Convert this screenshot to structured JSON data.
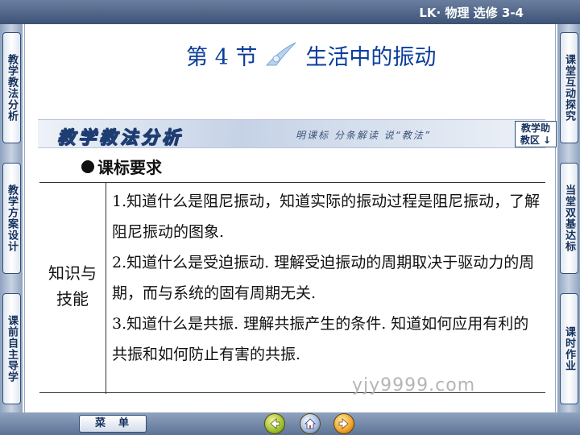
{
  "header": {
    "course": "LK· 物理  选修  3-4"
  },
  "left_tabs": [
    {
      "label": "教学教法分析"
    },
    {
      "label": "教学方案设计"
    },
    {
      "label": "课前自主导学"
    }
  ],
  "right_tabs": [
    {
      "label": "课堂互动探究"
    },
    {
      "label": "当堂双基达标"
    },
    {
      "label": "课时作业"
    }
  ],
  "title": {
    "section": "第 4 节",
    "name": "生活中的振动"
  },
  "banner": {
    "section_label": "教学教法分析",
    "slogan": "明课标  分条解读  说“教法”",
    "help_line1": "教学助",
    "help_line2": "教区 ↓"
  },
  "heading": "课标要求",
  "table": {
    "row_head_line1": "知识与",
    "row_head_line2": "技能",
    "items": [
      "1.知道什么是阻尼振动，知道实际的振动过程是阻尼振动，了解阻尼振动的图象.",
      "2.知道什么是受迫振动. 理解受迫振动的周期取决于驱动力的周期，而与系统的固有周期无关.",
      "3.知道什么是共振. 理解共振产生的条件. 知道如何应用有利的共振和如何防止有害的共振."
    ]
  },
  "watermark": "yjy9999.com",
  "footer": {
    "menu_label": "菜单",
    "nav_icons": [
      "prev-icon",
      "home-icon",
      "next-icon"
    ]
  }
}
